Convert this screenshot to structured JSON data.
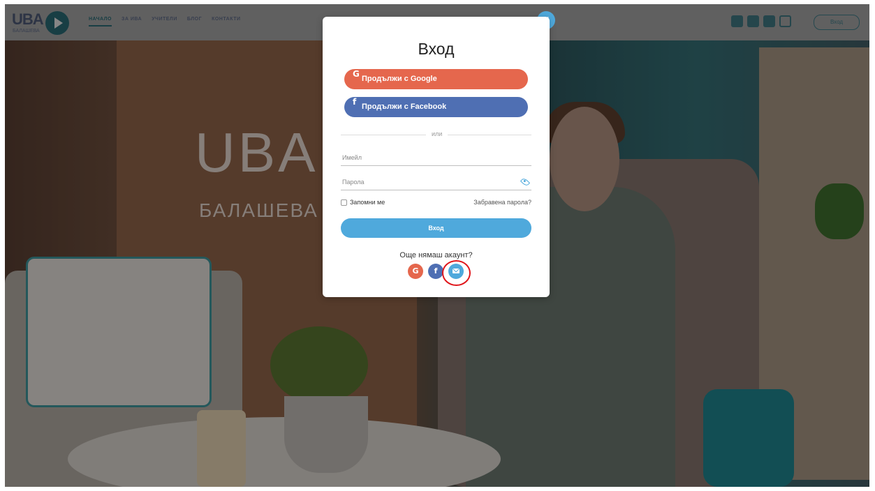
{
  "site": {
    "logo_text": "UBA",
    "logo_sub": "БАЛАШЕВА",
    "nav": [
      "НАЧАЛО",
      "ЗА ИВА",
      "УЧИТЕЛИ",
      "БЛОГ",
      "КОНТАКТИ"
    ],
    "social_icons": [
      "facebook-icon",
      "youtube-icon",
      "linkedin-icon",
      "instagram-icon"
    ],
    "login_label": "Вход",
    "hero_title": "UBA",
    "hero_subtitle": "БАЛАШЕВА"
  },
  "modal": {
    "title": "Вход",
    "google_label": "Продължи с Google",
    "facebook_label": "Продължи с Facebook",
    "google_icon": "G",
    "facebook_icon": "f",
    "divider": "или",
    "email_placeholder": "Имейл",
    "password_placeholder": "Парола",
    "remember_label": "Запомни ме",
    "forgot_label": "Забравена парола?",
    "submit_label": "Вход",
    "no_account": "Още нямаш акаунт?",
    "register_google": "G",
    "register_facebook": "f",
    "close": "×"
  },
  "colors": {
    "accent": "#4fa9dc",
    "google": "#e5674d",
    "facebook": "#4f6fb3",
    "highlight": "#e0171c"
  }
}
